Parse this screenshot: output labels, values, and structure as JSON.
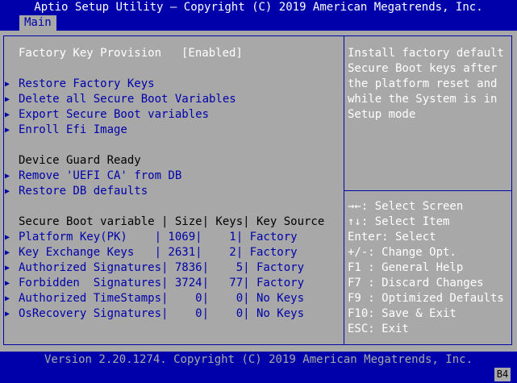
{
  "header": {
    "title": "Aptio Setup Utility – Copyright (C) 2019 American Megatrends, Inc.",
    "tabs": [
      {
        "label": "Main"
      }
    ]
  },
  "settings": {
    "factory_key_provision": {
      "label": "Factory Key Provision",
      "value": "[Enabled]"
    },
    "actions": [
      {
        "label": "Restore Factory Keys"
      },
      {
        "label": "Delete all Secure Boot Variables"
      },
      {
        "label": "Export Secure Boot variables"
      },
      {
        "label": "Enroll Efi Image"
      }
    ],
    "device_guard": {
      "heading": "Device Guard Ready",
      "items": [
        {
          "label": "Remove 'UEFI CA' from DB"
        },
        {
          "label": "Restore DB defaults"
        }
      ]
    },
    "variables_table": {
      "header": "Secure Boot variable | Size| Keys| Key Source",
      "rows": [
        {
          "text": "Platform Key(PK)    | 1069|    1| Factory"
        },
        {
          "text": "Key Exchange Keys   | 2631|    2| Factory"
        },
        {
          "text": "Authorized Signatures| 7836|    5| Factory"
        },
        {
          "text": "Forbidden  Signatures| 3724|   77| Factory"
        },
        {
          "text": "Authorized TimeStamps|    0|    0| No Keys"
        },
        {
          "text": "OsRecovery Signatures|    0|    0| No Keys"
        }
      ]
    }
  },
  "help": {
    "description": [
      "Install factory default",
      "Secure Boot keys after",
      "the platform reset and",
      "while the System is in",
      "Setup mode"
    ],
    "keys": [
      "→←: Select Screen",
      "↑↓: Select Item",
      "Enter: Select",
      "+/-: Change Opt.",
      "F1 : General Help",
      "F7 : Discard Changes",
      "F9 : Optimized Defaults",
      "F10: Save & Exit",
      "ESC: Exit"
    ]
  },
  "footer": {
    "version": "Version 2.20.1274. Copyright (C) 2019 American Megatrends, Inc.",
    "code": "B4"
  },
  "colors": {
    "background_blue": "#0000aa",
    "panel_grey": "#a8a8a8",
    "highlight_white": "#ffffff",
    "text_black": "#000000"
  },
  "icons": {
    "submenu_marker": "submenu-arrow-icon"
  }
}
